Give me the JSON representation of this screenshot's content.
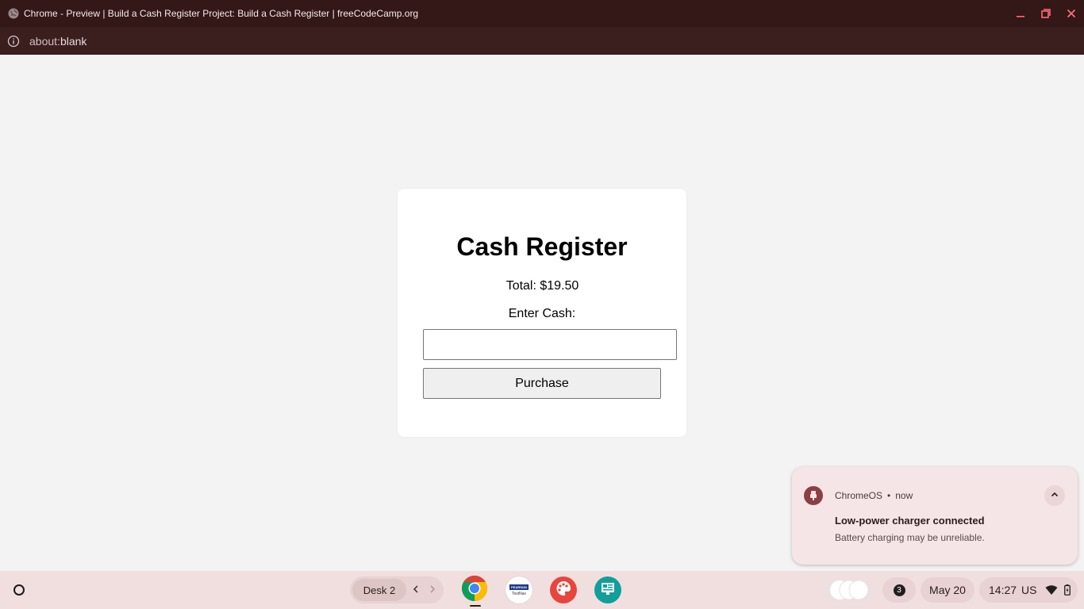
{
  "window": {
    "title": "Chrome - Preview | Build a Cash Register Project: Build a Cash Register | freeCodeCamp.org",
    "url_prefix": "about:",
    "url_rest": "blank"
  },
  "page": {
    "heading": "Cash Register",
    "total_text": "Total: $19.50",
    "cash_label": "Enter Cash:",
    "cash_value": "",
    "purchase_label": "Purchase"
  },
  "notification": {
    "source": "ChromeOS",
    "separator": "•",
    "time": "now",
    "title": "Low-power charger connected",
    "body": "Battery charging may be unreliable."
  },
  "shelf": {
    "desk_label": "Desk 2",
    "apps": [
      "chrome-icon",
      "pearson-testnav-icon",
      "paint-icon",
      "classroom-screen-icon"
    ],
    "pearson_top": "PEARSON",
    "pearson_bottom": "TestNav",
    "notification_count": "3",
    "date": "May 20",
    "time": "14:27",
    "locale": "US"
  },
  "colors": {
    "titlebar": "#341717",
    "addressbar": "#3b1e1e",
    "page_bg": "#f3f3f3",
    "shelf": "#f1dfe0",
    "notification_bg": "#f5e5e6",
    "notification_icon": "#8c3f43"
  }
}
